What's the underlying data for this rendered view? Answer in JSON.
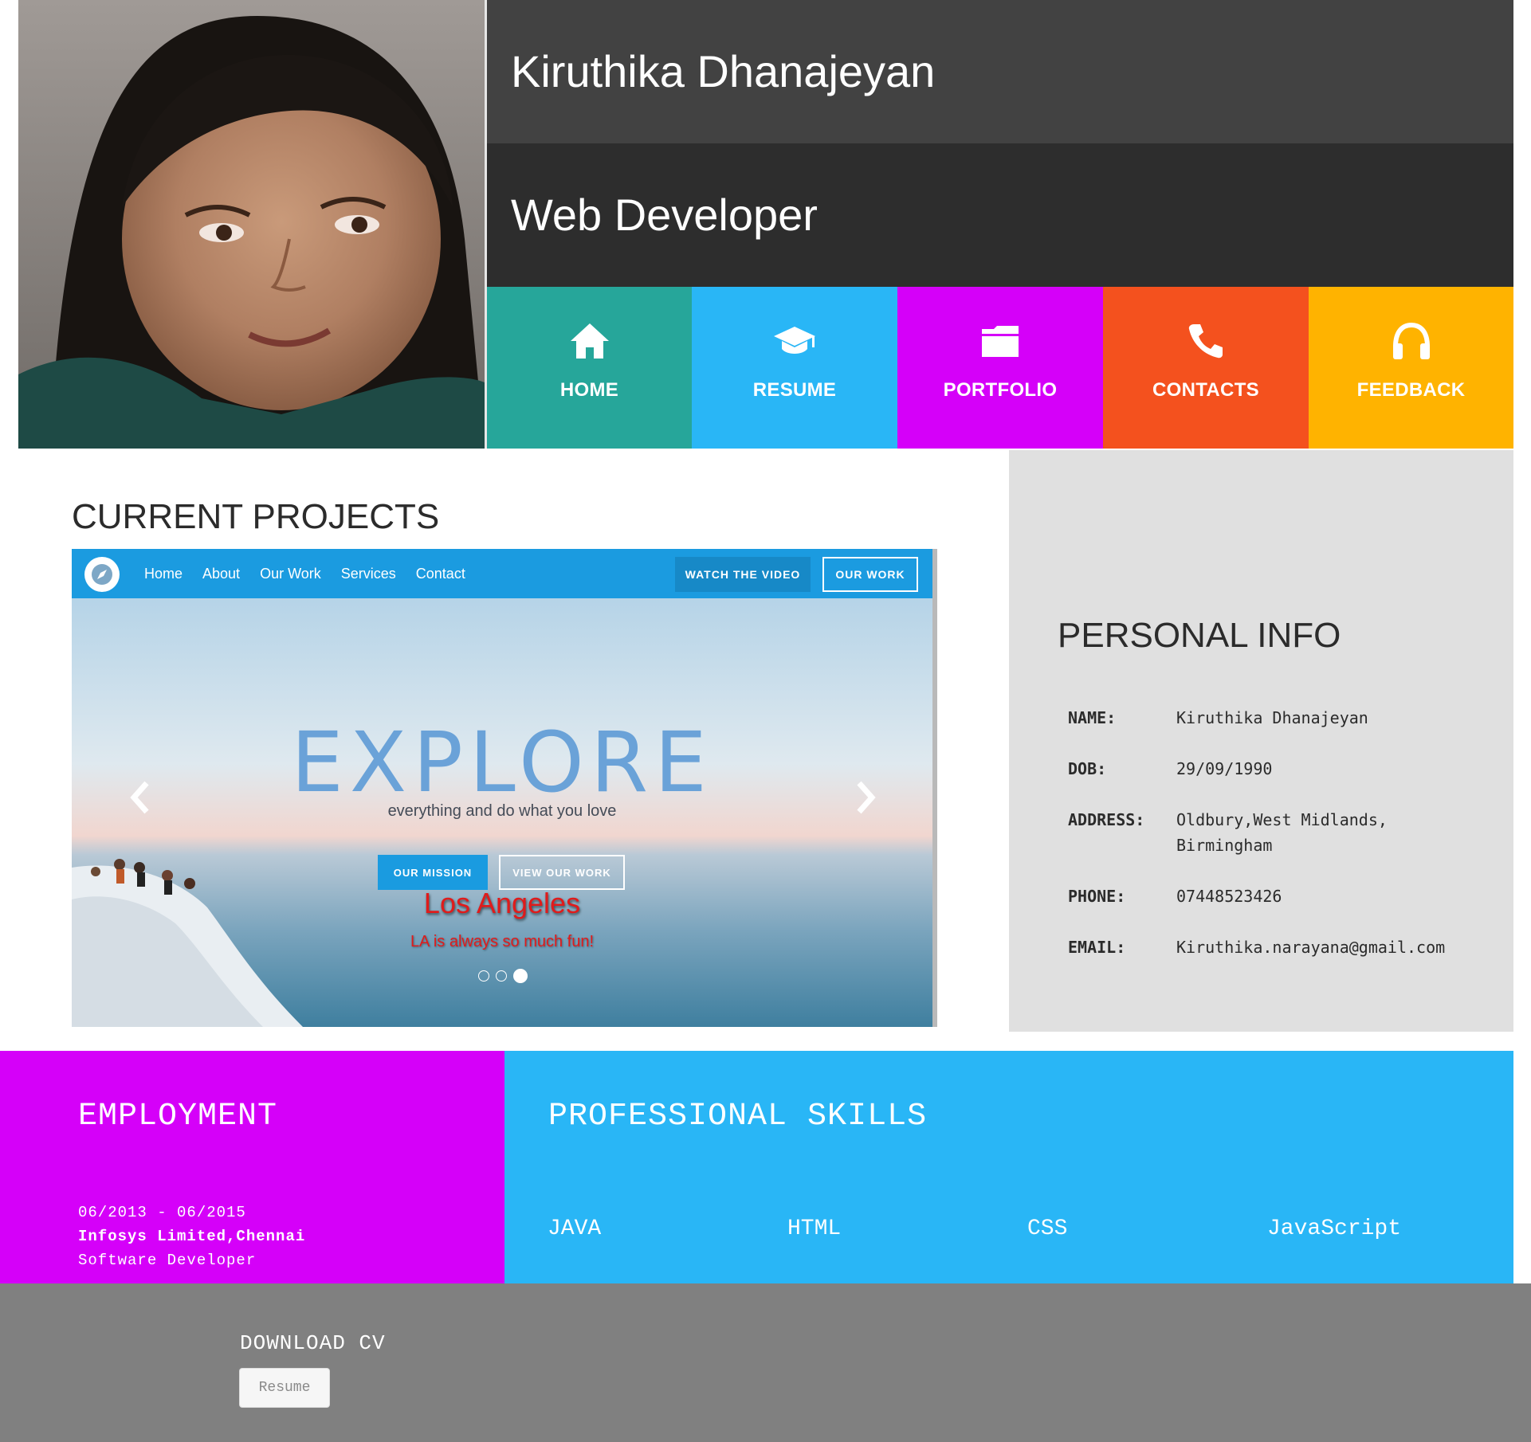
{
  "header": {
    "name": "Kiruthika Dhanajeyan",
    "role": "Web Developer"
  },
  "nav": [
    {
      "label": "HOME",
      "icon": "home-icon",
      "color": "#26a69a"
    },
    {
      "label": "RESUME",
      "icon": "graduation-cap-icon",
      "color": "#29b6f6"
    },
    {
      "label": "PORTFOLIO",
      "icon": "folder-icon",
      "color": "#d500f9"
    },
    {
      "label": "CONTACTS",
      "icon": "phone-icon",
      "color": "#f4511e"
    },
    {
      "label": "FEEDBACK",
      "icon": "headphones-icon",
      "color": "#ffb300"
    }
  ],
  "projects": {
    "title": "CURRENT PROJECTS",
    "slide": {
      "site_nav": [
        "Home",
        "About",
        "Our Work",
        "Services",
        "Contact"
      ],
      "watch_button": "WATCH THE VIDEO",
      "our_work_button": "OUR WORK",
      "headline": "EXPLORE",
      "subheadline": "everything and do what you love",
      "mission_button": "OUR MISSION",
      "view_button": "VIEW OUR WORK",
      "caption_title": "Los Angeles",
      "caption_text": "LA is always so much fun!"
    },
    "slide_count": 3,
    "active_slide": 3
  },
  "personal": {
    "title": "PERSONAL INFO",
    "rows": [
      {
        "label": "NAME:",
        "value": "Kiruthika Dhanajeyan"
      },
      {
        "label": "DOB:",
        "value": "29/09/1990"
      },
      {
        "label": "ADDRESS:",
        "value": "Oldbury,West Midlands,",
        "value2": "Birmingham"
      },
      {
        "label": "PHONE:",
        "value": "07448523426"
      },
      {
        "label": "EMAIL:",
        "value": "Kiruthika.narayana@gmail.com"
      }
    ]
  },
  "employment": {
    "title": "EMPLOYMENT",
    "period": "06/2013 - 06/2015",
    "company": "Infosys Limited,Chennai",
    "position": "Software Developer"
  },
  "skills": {
    "title": "PROFESSIONAL SKILLS",
    "items": [
      "JAVA",
      "HTML",
      "CSS",
      "JavaScript"
    ]
  },
  "footer": {
    "download_label": "DOWNLOAD CV",
    "resume_button": "Resume"
  },
  "colors": {
    "header_dark": "#424242",
    "header_darker": "#2d2d2d",
    "employment_bg": "#d500f9",
    "skills_bg": "#29b6f6",
    "personal_bg": "#e0e0e0",
    "footer_bg": "#808080"
  }
}
